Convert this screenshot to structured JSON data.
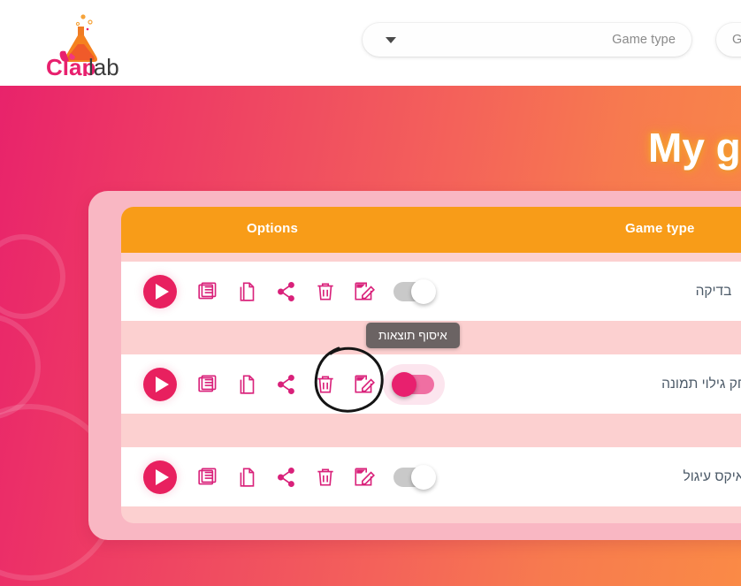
{
  "brand": {
    "name_part1": "Clap",
    "name_part2": "lab",
    "logo_icon": "flask-icon",
    "pink": "#e8206e",
    "dark": "#3b3b3b"
  },
  "header": {
    "game_type_filter": {
      "icon": "chevron-down-icon",
      "value": "",
      "placeholder": "Game type"
    },
    "secondary_filter": {
      "value": "G"
    }
  },
  "banner": {
    "title": "My g",
    "gradient_start": "#e8236b",
    "gradient_end": "#fa8a46"
  },
  "table": {
    "columns": {
      "options": "Options",
      "game_type": "Game type"
    },
    "header_color": "#f89c18",
    "rows": [
      {
        "game_name": "בדיקה",
        "play": "play-icon",
        "results": "results-icon",
        "duplicate": "duplicate-icon",
        "share": "share-icon",
        "delete": "trash-icon",
        "edit": "edit-icon",
        "toggle_state": "off"
      },
      {
        "game_name": "משחק גילוי תמונה",
        "play": "play-icon",
        "results": "results-icon",
        "duplicate": "duplicate-icon",
        "share": "share-icon",
        "delete": "trash-icon",
        "edit": "edit-icon",
        "toggle_state": "on"
      },
      {
        "game_name": "איקס עיגול",
        "play": "play-icon",
        "results": "results-icon",
        "duplicate": "duplicate-icon",
        "share": "share-icon",
        "delete": "trash-icon",
        "edit": "edit-icon",
        "toggle_state": "off"
      }
    ]
  },
  "tooltip": {
    "text": "איסוף תוצאות"
  },
  "annotation": {
    "type": "hand-drawn-circle",
    "target": "edit-icon-row-2"
  },
  "colors": {
    "accent_pink": "#e8206e",
    "orange": "#f89c18",
    "card_light": "#fcd0d0",
    "card_outer": "#f9b7c3",
    "toggle_off": "#c9c9c9",
    "toggle_on": "#f06fa2",
    "text_dark": "#4c5a68"
  }
}
